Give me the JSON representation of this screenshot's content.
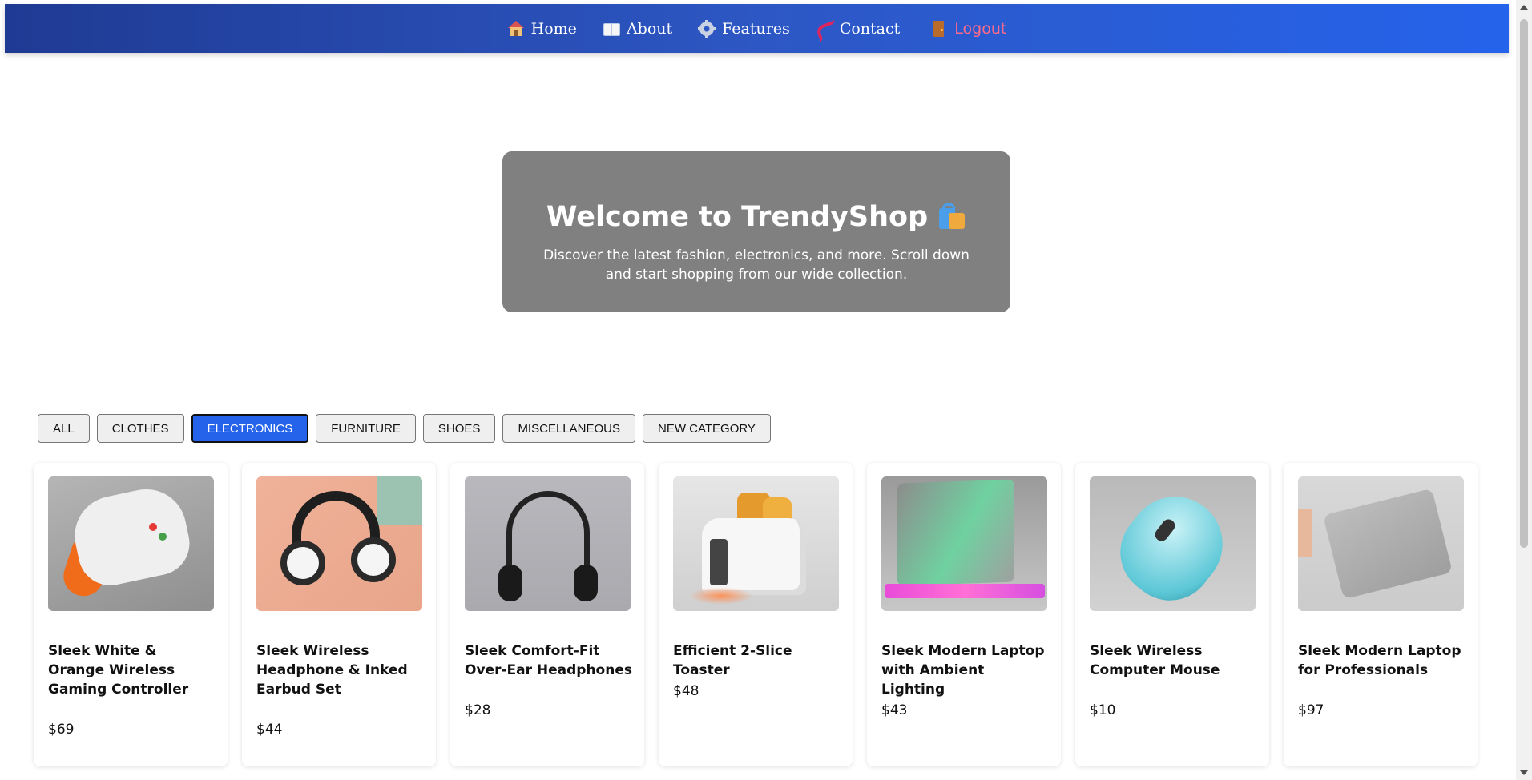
{
  "nav": {
    "items": [
      {
        "label": "Home",
        "icon": "home-icon"
      },
      {
        "label": "About",
        "icon": "book-icon"
      },
      {
        "label": "Features",
        "icon": "gear-icon"
      },
      {
        "label": "Contact",
        "icon": "phone-icon"
      }
    ],
    "logout": {
      "label": "Logout",
      "icon": "door-icon",
      "color": "#ff6b8a"
    }
  },
  "hero": {
    "title": "Welcome to TrendyShop",
    "title_icon": "shopping-bags-icon",
    "text": "Discover the latest fashion, electronics, and more. Scroll down and start shopping from our wide collection."
  },
  "filters": {
    "items": [
      "ALL",
      "CLOTHES",
      "ELECTRONICS",
      "FURNITURE",
      "SHOES",
      "MISCELLANEOUS",
      "NEW CATEGORY"
    ],
    "selected": "ELECTRONICS",
    "active_color": "#2563eb"
  },
  "products": [
    {
      "title": "Sleek White & Orange Wireless Gaming Controller",
      "price": "$69"
    },
    {
      "title": "Sleek Wireless Headphone & Inked Earbud Set",
      "price": "$44"
    },
    {
      "title": "Sleek Comfort-Fit Over-Ear Headphones",
      "price": "$28"
    },
    {
      "title": "Efficient 2-Slice Toaster",
      "price": "$48"
    },
    {
      "title": "Sleek Modern Laptop with Ambient Lighting",
      "price": "$43"
    },
    {
      "title": "Sleek Wireless Computer Mouse",
      "price": "$10"
    },
    {
      "title": "Sleek Modern Laptop for Professionals",
      "price": "$97"
    }
  ],
  "colors": {
    "nav_gradient_start": "#1f3a93",
    "nav_gradient_end": "#2563eb",
    "hero_bg": "#808080"
  }
}
